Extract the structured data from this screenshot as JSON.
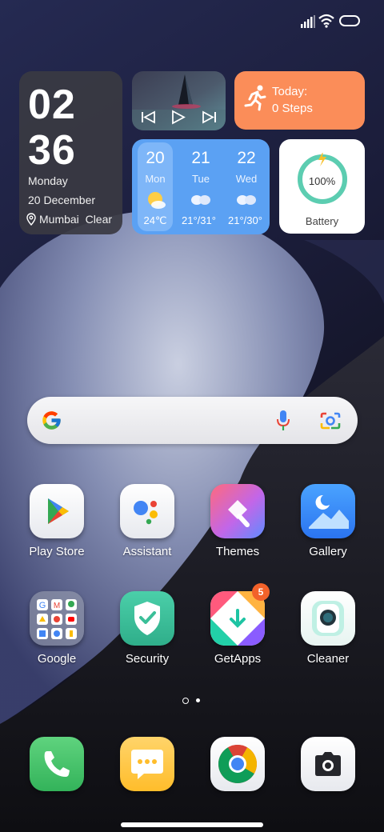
{
  "colors": {
    "steps_widget": "#fb8d59",
    "weather_widget": "#5ba1f3",
    "battery_ring": "#5ccdb1",
    "badge": "#f2622a"
  },
  "status_bar": {
    "icons": [
      "signal-icon",
      "wifi-icon",
      "battery-icon"
    ]
  },
  "clock_widget": {
    "hour": "02",
    "minute": "36",
    "day": "Monday",
    "date": "20 December",
    "location": "Mumbai",
    "condition": "Clear"
  },
  "music_widget": {
    "icons": [
      "previous-icon",
      "play-icon",
      "next-icon"
    ]
  },
  "steps_widget": {
    "label": "Today:",
    "steps": "0 Steps"
  },
  "weather_widget": {
    "days": [
      {
        "num": "20",
        "name": "Mon",
        "temp": "24℃",
        "icon": "sunny-icon"
      },
      {
        "num": "21",
        "name": "Tue",
        "temp": "21°/31°",
        "icon": "cloudy-icon"
      },
      {
        "num": "22",
        "name": "Wed",
        "temp": "21°/30°",
        "icon": "cloudy-icon"
      }
    ]
  },
  "battery_widget": {
    "level": 1.0,
    "percent": "100%",
    "label": "Battery"
  },
  "search_bar": {
    "icons": [
      "google-logo-icon",
      "microphone-icon",
      "lens-camera-icon"
    ]
  },
  "apps": [
    {
      "label": "Play Store",
      "icon": "play-store-icon"
    },
    {
      "label": "Assistant",
      "icon": "assistant-icon"
    },
    {
      "label": "Themes",
      "icon": "themes-icon"
    },
    {
      "label": "Gallery",
      "icon": "gallery-icon"
    },
    {
      "label": "Google",
      "icon": "google-folder-icon"
    },
    {
      "label": "Security",
      "icon": "security-icon"
    },
    {
      "label": "GetApps",
      "icon": "getapps-icon",
      "badge": "5"
    },
    {
      "label": "Cleaner",
      "icon": "cleaner-icon"
    }
  ],
  "page_indicator": {
    "count": 2,
    "current": 0
  },
  "dock": [
    {
      "icon": "phone-icon"
    },
    {
      "icon": "messages-icon"
    },
    {
      "icon": "chrome-icon"
    },
    {
      "icon": "camera-icon"
    }
  ]
}
